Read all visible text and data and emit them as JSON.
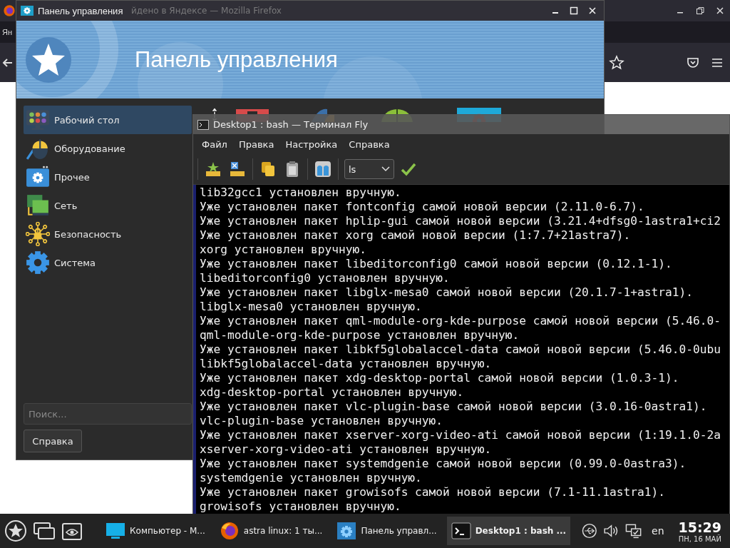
{
  "background_window": {
    "title": "йдено в Яндексе — Mozilla Firefox",
    "tab": "Ян"
  },
  "control_panel": {
    "title": "Панель управления",
    "banner_title": "Панель управления",
    "categories": [
      {
        "label": "Рабочий стол",
        "selected": true
      },
      {
        "label": "Оборудование",
        "selected": false
      },
      {
        "label": "Прочее",
        "selected": false
      },
      {
        "label": "Сеть",
        "selected": false
      },
      {
        "label": "Безопасность",
        "selected": false
      },
      {
        "label": "Система",
        "selected": false
      }
    ],
    "search": {
      "placeholder": "Поиск..."
    },
    "help_button": "Справка"
  },
  "terminal": {
    "title": "Desktop1 : bash — Терминал Fly",
    "menu": [
      "Файл",
      "Правка",
      "Настройка",
      "Справка"
    ],
    "command": "ls",
    "lines": [
      "lib32gcc1 установлен вручную.",
      "Уже установлен пакет fontconfig самой новой версии (2.11.0-6.7).",
      "Уже установлен пакет hplip-gui самой новой версии (3.21.4+dfsg0-1astra1+ci2",
      "Уже установлен пакет xorg самой новой версии (1:7.7+21astra7).",
      "xorg установлен вручную.",
      "Уже установлен пакет libeditorconfig0 самой новой версии (0.12.1-1).",
      "libeditorconfig0 установлен вручную.",
      "Уже установлен пакет libglx-mesa0 самой новой версии (20.1.7-1+astra1).",
      "libglx-mesa0 установлен вручную.",
      "Уже установлен пакет qml-module-org-kde-purpose самой новой версии (5.46.0-",
      "qml-module-org-kde-purpose установлен вручную.",
      "Уже установлен пакет libkf5globalaccel-data самой новой версии (5.46.0-0ubu",
      "libkf5globalaccel-data установлен вручную.",
      "Уже установлен пакет xdg-desktop-portal самой новой версии (1.0.3-1).",
      "xdg-desktop-portal установлен вручную.",
      "Уже установлен пакет vlc-plugin-base самой новой версии (3.0.16-0astra1).",
      "vlc-plugin-base установлен вручную.",
      "Уже установлен пакет xserver-xorg-video-ati самой новой версии (1:19.1.0-2a",
      "xserver-xorg-video-ati установлен вручную.",
      "Уже установлен пакет systemdgenie самой новой версии (0.99.0-0astra3).",
      "systemdgenie установлен вручную.",
      "Уже установлен пакет growisofs самой новой версии (7.1-11.1astra1).",
      "growisofs установлен вручную."
    ]
  },
  "taskbar": {
    "tasks": [
      {
        "label": "Компьютер - М...",
        "selected": false
      },
      {
        "label": "astra linux: 1 ты...",
        "selected": false
      },
      {
        "label": "Панель управл...",
        "selected": false
      },
      {
        "label": "Desktop1 : bash ...",
        "selected": true
      }
    ],
    "language": "en",
    "time": "15:29",
    "date": "ПН, 16 МАЙ"
  }
}
